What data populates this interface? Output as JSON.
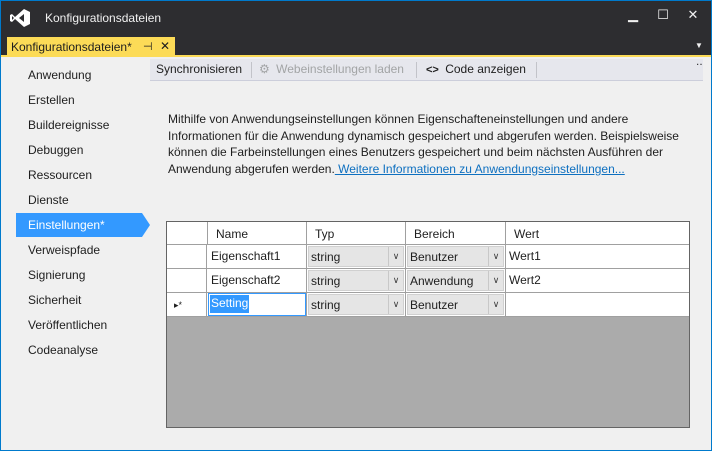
{
  "window": {
    "title": "Konfigurationsdateien",
    "controls": {
      "minimize": "▁",
      "maximize": "☐",
      "close": "✕"
    }
  },
  "tabs": {
    "document_tab": "Konfigurationsdateien*",
    "pin": "⊣",
    "close": "✕",
    "dropdown": "▼"
  },
  "sidebar": {
    "items": [
      {
        "label": "Anwendung"
      },
      {
        "label": "Erstellen"
      },
      {
        "label": "Buildereignisse"
      },
      {
        "label": "Debuggen"
      },
      {
        "label": "Ressourcen"
      },
      {
        "label": "Dienste"
      },
      {
        "label": "Einstellungen*"
      },
      {
        "label": "Verweispfade"
      },
      {
        "label": "Signierung"
      },
      {
        "label": "Sicherheit"
      },
      {
        "label": "Veröffentlichen"
      },
      {
        "label": "Codeanalyse"
      }
    ],
    "active_index": 6
  },
  "toolbar": {
    "sync_label": "Synchronisieren",
    "web_label": "Webeinstellungen laden",
    "code_label": "Code anzeigen",
    "code_icon": "<>",
    "web_icon": "⚙",
    "overflow": "‥"
  },
  "info": {
    "text": "Mithilfe von Anwendungseinstellungen können Eigenschafteneinstellungen und andere Informationen für die Anwendung dynamisch gespeichert und abgerufen werden. Beispielsweise können die Farbeinstellungen eines Benutzers gespeichert und beim nächsten Ausführen der Anwendung abgerufen werden.",
    "link": " Weitere Informationen zu Anwendungseinstellungen..."
  },
  "grid": {
    "columns": [
      "Name",
      "Typ",
      "Bereich",
      "Wert"
    ],
    "rows": [
      {
        "marker": "",
        "name": "Eigenschaft1",
        "type": "string",
        "scope": "Benutzer",
        "value": "Wert1"
      },
      {
        "marker": "",
        "name": "Eigenschaft2",
        "type": "string",
        "scope": "Anwendung",
        "value": "Wert2"
      },
      {
        "marker": "▸*",
        "name": "Setting",
        "type": "string",
        "scope": "Benutzer",
        "value": ""
      }
    ],
    "combo_arrow": "∨"
  },
  "colors": {
    "accent": "#007acc",
    "tab_active": "#fcdb57",
    "nav_active": "#3399ff",
    "chrome_dark": "#2d2d30",
    "link": "#0e70c0"
  }
}
